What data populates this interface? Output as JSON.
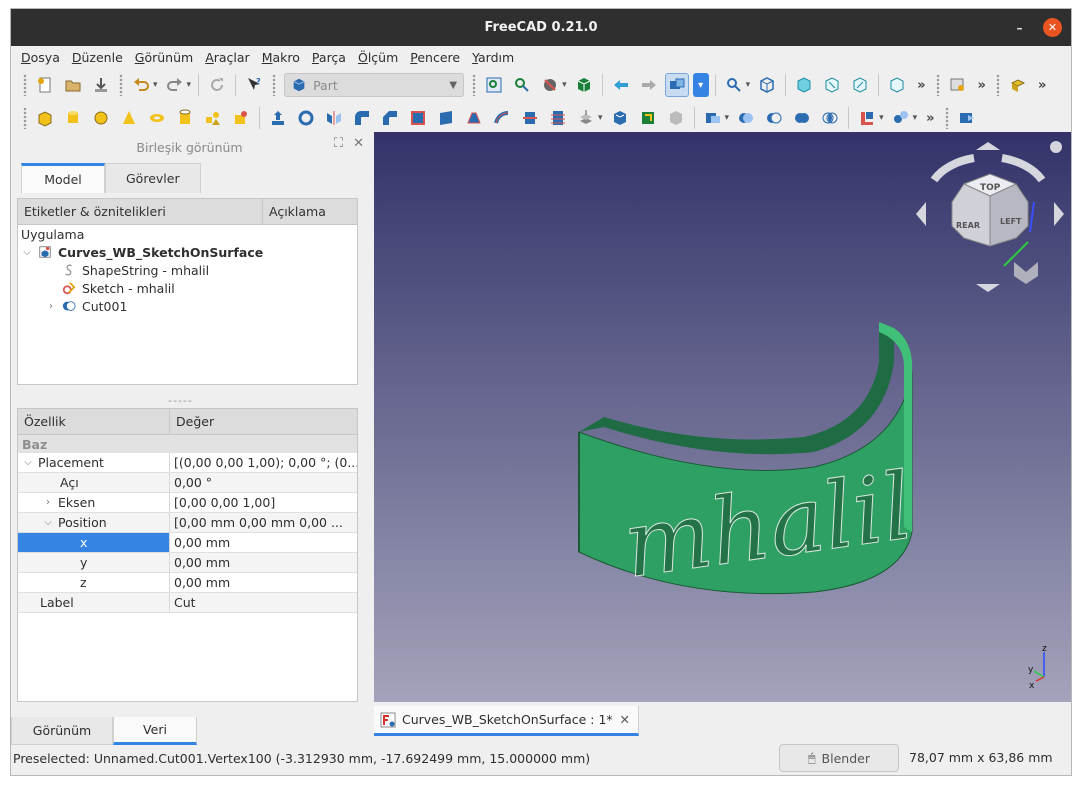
{
  "window": {
    "title": "FreeCAD 0.21.0",
    "minimize_glyph": "–",
    "close_glyph": "✕"
  },
  "menu": [
    "Dosya",
    "Düzenle",
    "Görünüm",
    "Araçlar",
    "Makro",
    "Parça",
    "Ölçüm",
    "Pencere",
    "Yardım"
  ],
  "toolbar": {
    "workbench": "Part",
    "more_glyph": "»"
  },
  "combo_view": {
    "title": "Birleşik görünüm",
    "tabs": [
      "Model",
      "Görevler"
    ],
    "tree_headers": [
      "Etiketler & öznitelikleri",
      "Açıklama"
    ],
    "tree": {
      "root": "Uygulama",
      "document": "Curves_WB_SketchOnSurface",
      "items": [
        "ShapeString - mhalil",
        "Sketch - mhalil",
        "Cut001"
      ]
    },
    "splitter": "-----",
    "property_headers": [
      "Özellik",
      "Değer"
    ],
    "group": "Baz",
    "properties": [
      {
        "name": "Placement",
        "value": "[(0,00 0,00 1,00); 0,00 °; (0..."
      },
      {
        "name": "Açı",
        "value": "0,00 °"
      },
      {
        "name": "Eksen",
        "value": "[0,00 0,00 1,00]"
      },
      {
        "name": "Position",
        "value": "[0,00 mm  0,00 mm  0,00 ..."
      },
      {
        "name": "x",
        "value": "0,00 mm"
      },
      {
        "name": "y",
        "value": "0,00 mm"
      },
      {
        "name": "z",
        "value": "0,00 mm"
      },
      {
        "name": "Label",
        "value": "Cut"
      }
    ],
    "bottom_tabs": [
      "Görünüm",
      "Veri"
    ]
  },
  "view": {
    "engraved_text": "mhalil",
    "navcube": {
      "top": "TOP",
      "rear": "REAR",
      "left": "LEFT"
    },
    "axes": {
      "x": "x",
      "y": "y",
      "z": "z"
    },
    "colors": {
      "part": "#2fa063",
      "bg_top": "#33336a",
      "bg_bottom": "#a3a3bb"
    }
  },
  "document_tab": {
    "label": "Curves_WB_SketchOnSurface : 1*",
    "close": "✕"
  },
  "status": {
    "preselected": "Preselected: Unnamed.Cut001.Vertex100 (-3.312930 mm, -17.692499 mm, 15.000000 mm)",
    "nav_style": "Blender",
    "dimensions": "78,07 mm x 63,86 mm"
  }
}
